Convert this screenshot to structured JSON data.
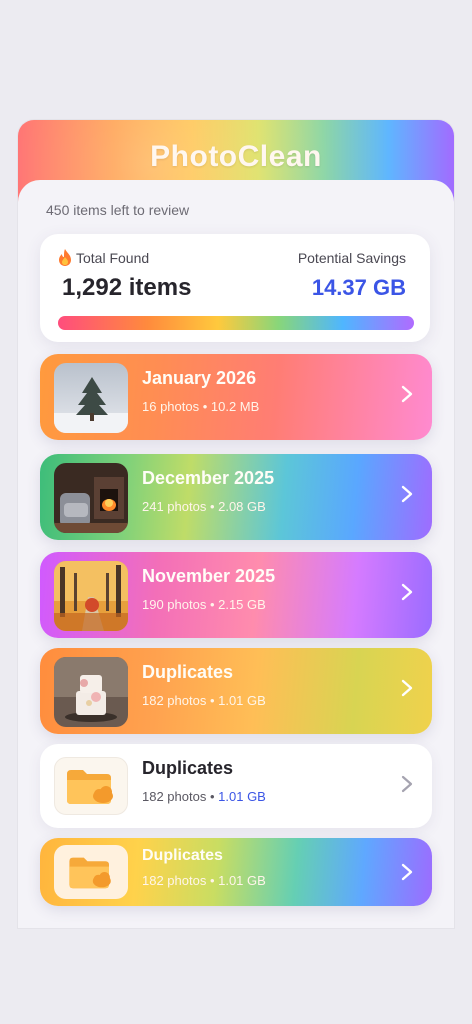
{
  "app": {
    "title": "PhotoClean"
  },
  "review": {
    "remaining_text": "450 items left to review"
  },
  "summary": {
    "found_label": "Total Found",
    "found_value": "1,292 items",
    "savings_label": "Potential Savings",
    "savings_value": "14.37 GB"
  },
  "groups": [
    {
      "name": "January 2026",
      "meta": "16 photos • 10.2 MB",
      "thumb": "snowy-tree"
    },
    {
      "name": "December 2025",
      "meta": "241 photos • 2.08 GB",
      "thumb": "fireplace-chair"
    },
    {
      "name": "November 2025",
      "meta": "190 photos • 2.15 GB",
      "thumb": "autumn-path"
    },
    {
      "name": "Duplicates",
      "meta": "182 photos • 1.01 GB",
      "thumb": "cake"
    },
    {
      "name": "Duplicates",
      "count": "182 photos",
      "separator": "•",
      "size": "1.01 GB",
      "thumb": "folder-cloud-icon"
    },
    {
      "name": "Duplicates",
      "meta": "182 photos • 1.01 GB",
      "thumb": "folder-cloud-icon"
    }
  ],
  "colors": {
    "accent": "#3b55e6",
    "text": "#27252c"
  }
}
